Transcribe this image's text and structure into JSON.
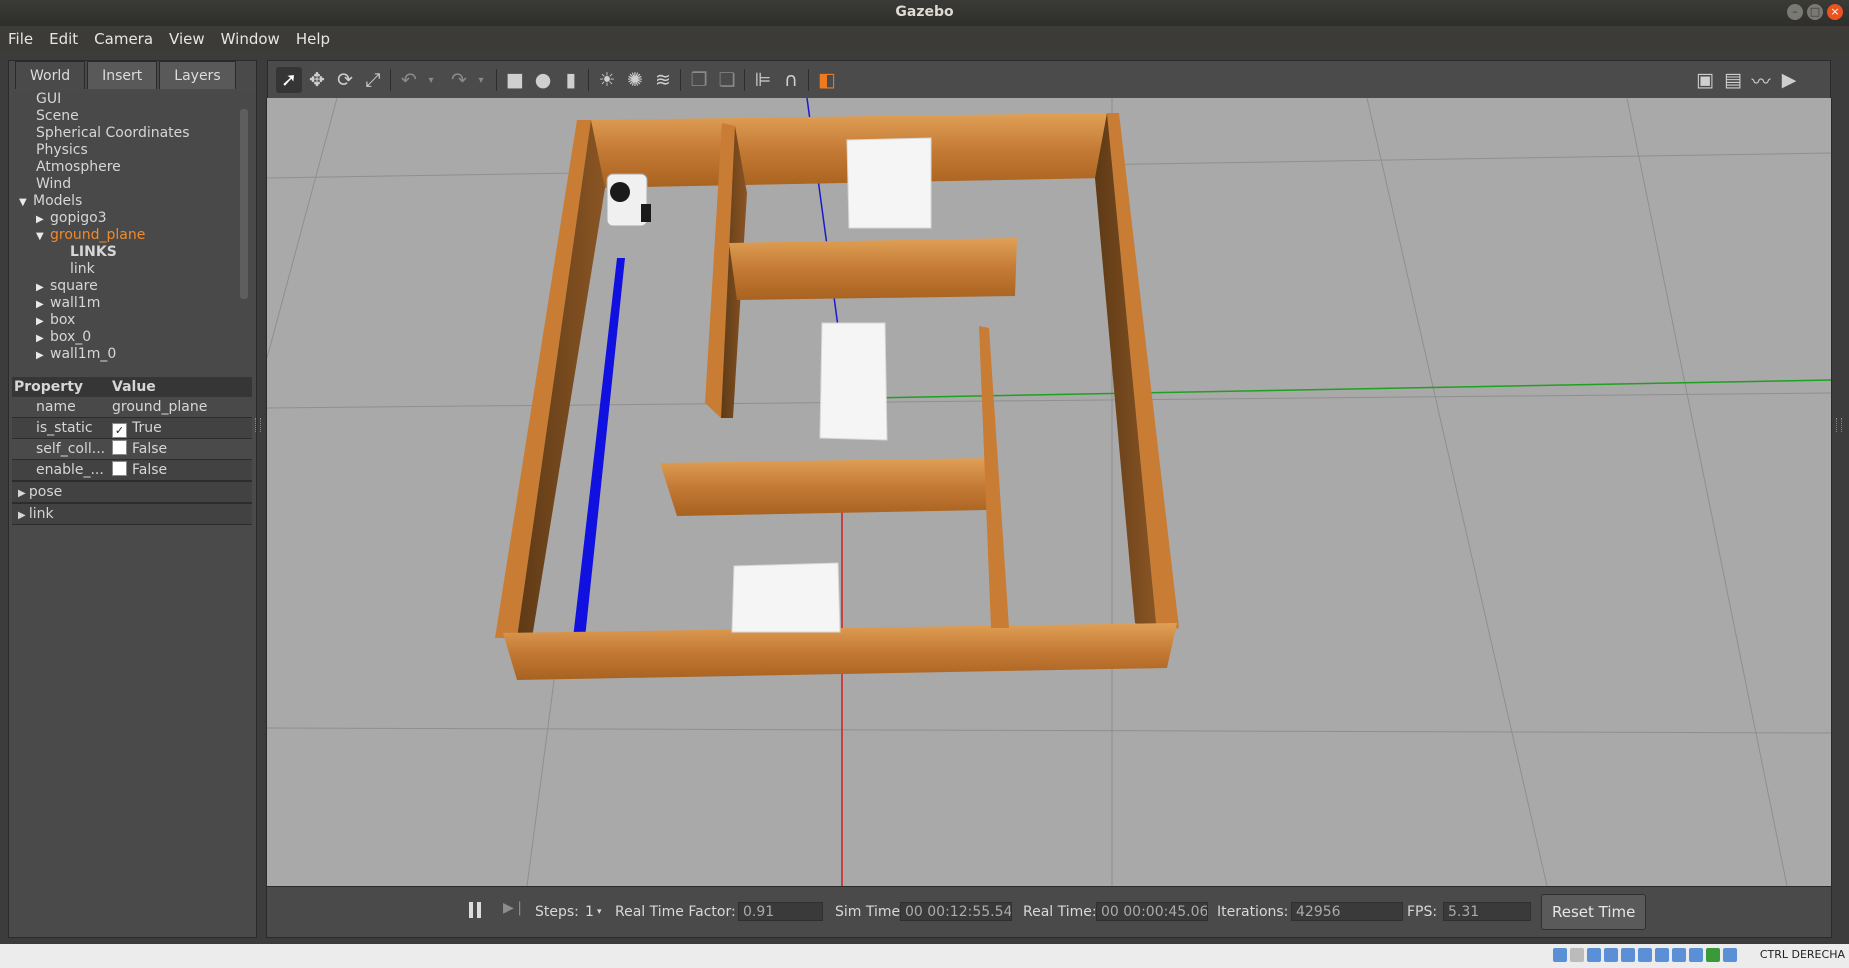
{
  "window": {
    "title": "Gazebo"
  },
  "menu": [
    "File",
    "Edit",
    "Camera",
    "View",
    "Window",
    "Help"
  ],
  "left_panel": {
    "tabs": [
      "World",
      "Insert",
      "Layers"
    ],
    "tree": [
      {
        "label": "GUI",
        "indent": 1,
        "arrow": ""
      },
      {
        "label": "Scene",
        "indent": 1,
        "arrow": ""
      },
      {
        "label": "Spherical Coordinates",
        "indent": 1,
        "arrow": ""
      },
      {
        "label": "Physics",
        "indent": 1,
        "arrow": ""
      },
      {
        "label": "Atmosphere",
        "indent": 1,
        "arrow": ""
      },
      {
        "label": "Wind",
        "indent": 1,
        "arrow": ""
      },
      {
        "label": "Models",
        "indent": 0,
        "arrow": "down"
      },
      {
        "label": "gopigo3",
        "indent": 1,
        "arrow": "right"
      },
      {
        "label": "ground_plane",
        "indent": 1,
        "arrow": "down",
        "selected": true
      },
      {
        "label": "LINKS",
        "indent": 3,
        "arrow": "",
        "bold": true
      },
      {
        "label": "link",
        "indent": 3,
        "arrow": ""
      },
      {
        "label": "square",
        "indent": 1,
        "arrow": "right"
      },
      {
        "label": "wall1m",
        "indent": 1,
        "arrow": "right"
      },
      {
        "label": "box",
        "indent": 1,
        "arrow": "right"
      },
      {
        "label": "box_0",
        "indent": 1,
        "arrow": "right"
      },
      {
        "label": "wall1m_0",
        "indent": 1,
        "arrow": "right"
      }
    ],
    "properties": {
      "header_key": "Property",
      "header_value": "Value",
      "rows": [
        {
          "key": "name",
          "value": "ground_plane",
          "checkbox": null
        },
        {
          "key": "is_static",
          "value": "True",
          "checkbox": true
        },
        {
          "key": "self_coll...",
          "value": "False",
          "checkbox": false
        },
        {
          "key": "enable_...",
          "value": "False",
          "checkbox": false
        },
        {
          "key": "pose",
          "value": "",
          "checkbox": null,
          "expander": true
        },
        {
          "key": "link",
          "value": "",
          "checkbox": null,
          "expander": true
        }
      ]
    }
  },
  "toolbar": {
    "icons": [
      "select-arrow-icon",
      "translate-icon",
      "rotate-icon",
      "scale-icon",
      "undo-icon",
      "undo-dropdown-icon",
      "redo-icon",
      "redo-dropdown-icon",
      "box-shape-icon",
      "sphere-shape-icon",
      "cylinder-shape-icon",
      "point-light-icon",
      "spot-light-icon",
      "directional-light-icon",
      "copy-icon",
      "paste-icon",
      "align-icon",
      "snap-icon",
      "view-angle-icon",
      "screenshot-icon",
      "log-icon",
      "plot-icon",
      "video-record-icon"
    ]
  },
  "bottom_bar": {
    "steps_label": "Steps:",
    "steps_value": "1",
    "rtf_label": "Real Time Factor:",
    "rtf_value": "0.91",
    "sim_time_label": "Sim Time:",
    "sim_time_value": "00 00:12:55.544",
    "real_time_label": "Real Time:",
    "real_time_value": "00 00:00:45.064",
    "iterations_label": "Iterations:",
    "iterations_value": "42956",
    "fps_label": "FPS:",
    "fps_value": "5.31",
    "reset_label": "Reset Time"
  },
  "statusbar": {
    "right_text": "CTRL DERECHA"
  },
  "colors": {
    "accent": "#f08a2a",
    "close": "#e95420",
    "wall": "#c98238",
    "ground": "#a9a9a9"
  }
}
